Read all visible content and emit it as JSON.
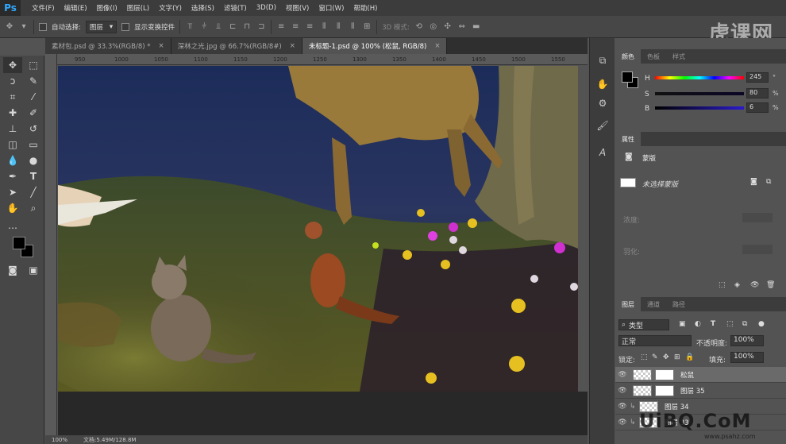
{
  "app": {
    "logo": "Ps"
  },
  "menu": [
    "文件(F)",
    "编辑(E)",
    "图像(I)",
    "图层(L)",
    "文字(Y)",
    "选择(S)",
    "滤镜(T)",
    "3D(D)",
    "视图(V)",
    "窗口(W)",
    "帮助(H)"
  ],
  "options": {
    "auto_select_label": "自动选择:",
    "auto_select_value": "图层",
    "show_transform_label": "显示变换控件",
    "mode3d_label": "3D 模式:"
  },
  "watermark": "虎课网",
  "tabs": [
    {
      "label": "素材包.psd @ 33.3%(RGB/8) *",
      "close": "×"
    },
    {
      "label": "深林之光.jpg @ 66.7%(RGB/8#)",
      "close": "×"
    },
    {
      "label": "未标题-1.psd @ 100% (松鼠, RGB/8)",
      "close": "×"
    }
  ],
  "ruler": {
    "h_ticks": [
      "950",
      "1000",
      "1050",
      "1100",
      "1150",
      "1200",
      "1250",
      "1300",
      "1350",
      "1400",
      "1450",
      "1500",
      "1550"
    ]
  },
  "status": {
    "zoom": "100%",
    "doc": "文档:5.49M/128.8M"
  },
  "color_panel": {
    "tabs": [
      "颜色",
      "色板",
      "样式"
    ],
    "h": {
      "label": "H",
      "value": "245",
      "unit": "°"
    },
    "s": {
      "label": "S",
      "value": "80",
      "unit": "%"
    },
    "b": {
      "label": "B",
      "value": "6",
      "unit": "%"
    }
  },
  "properties_panel": {
    "title": "属性",
    "subtitle": "蒙版",
    "no_mask": "未选择蒙版",
    "density_label": "浓度:",
    "feather_label": "羽化:"
  },
  "layers_panel": {
    "tabs": [
      "图层",
      "通道",
      "路径"
    ],
    "filter_label": "类型",
    "blend_mode": "正常",
    "opacity_label": "不透明度:",
    "opacity_value": "100%",
    "lock_label": "锁定:",
    "fill_label": "填充:",
    "fill_value": "100%",
    "layers": [
      {
        "name": "松鼠",
        "selected": true
      },
      {
        "name": "图层 35",
        "selected": false
      },
      {
        "name": "图层 34",
        "selected": false
      },
      {
        "name": "图层 33",
        "selected": false
      }
    ]
  },
  "bottom_watermark": "UiBQ.CoM",
  "bottom_watermark_sub": "www.psahz.com",
  "colors": {
    "accent": "#31a8ff",
    "fg_swatch": "#000000",
    "bg_swatch": "#ffffff"
  }
}
